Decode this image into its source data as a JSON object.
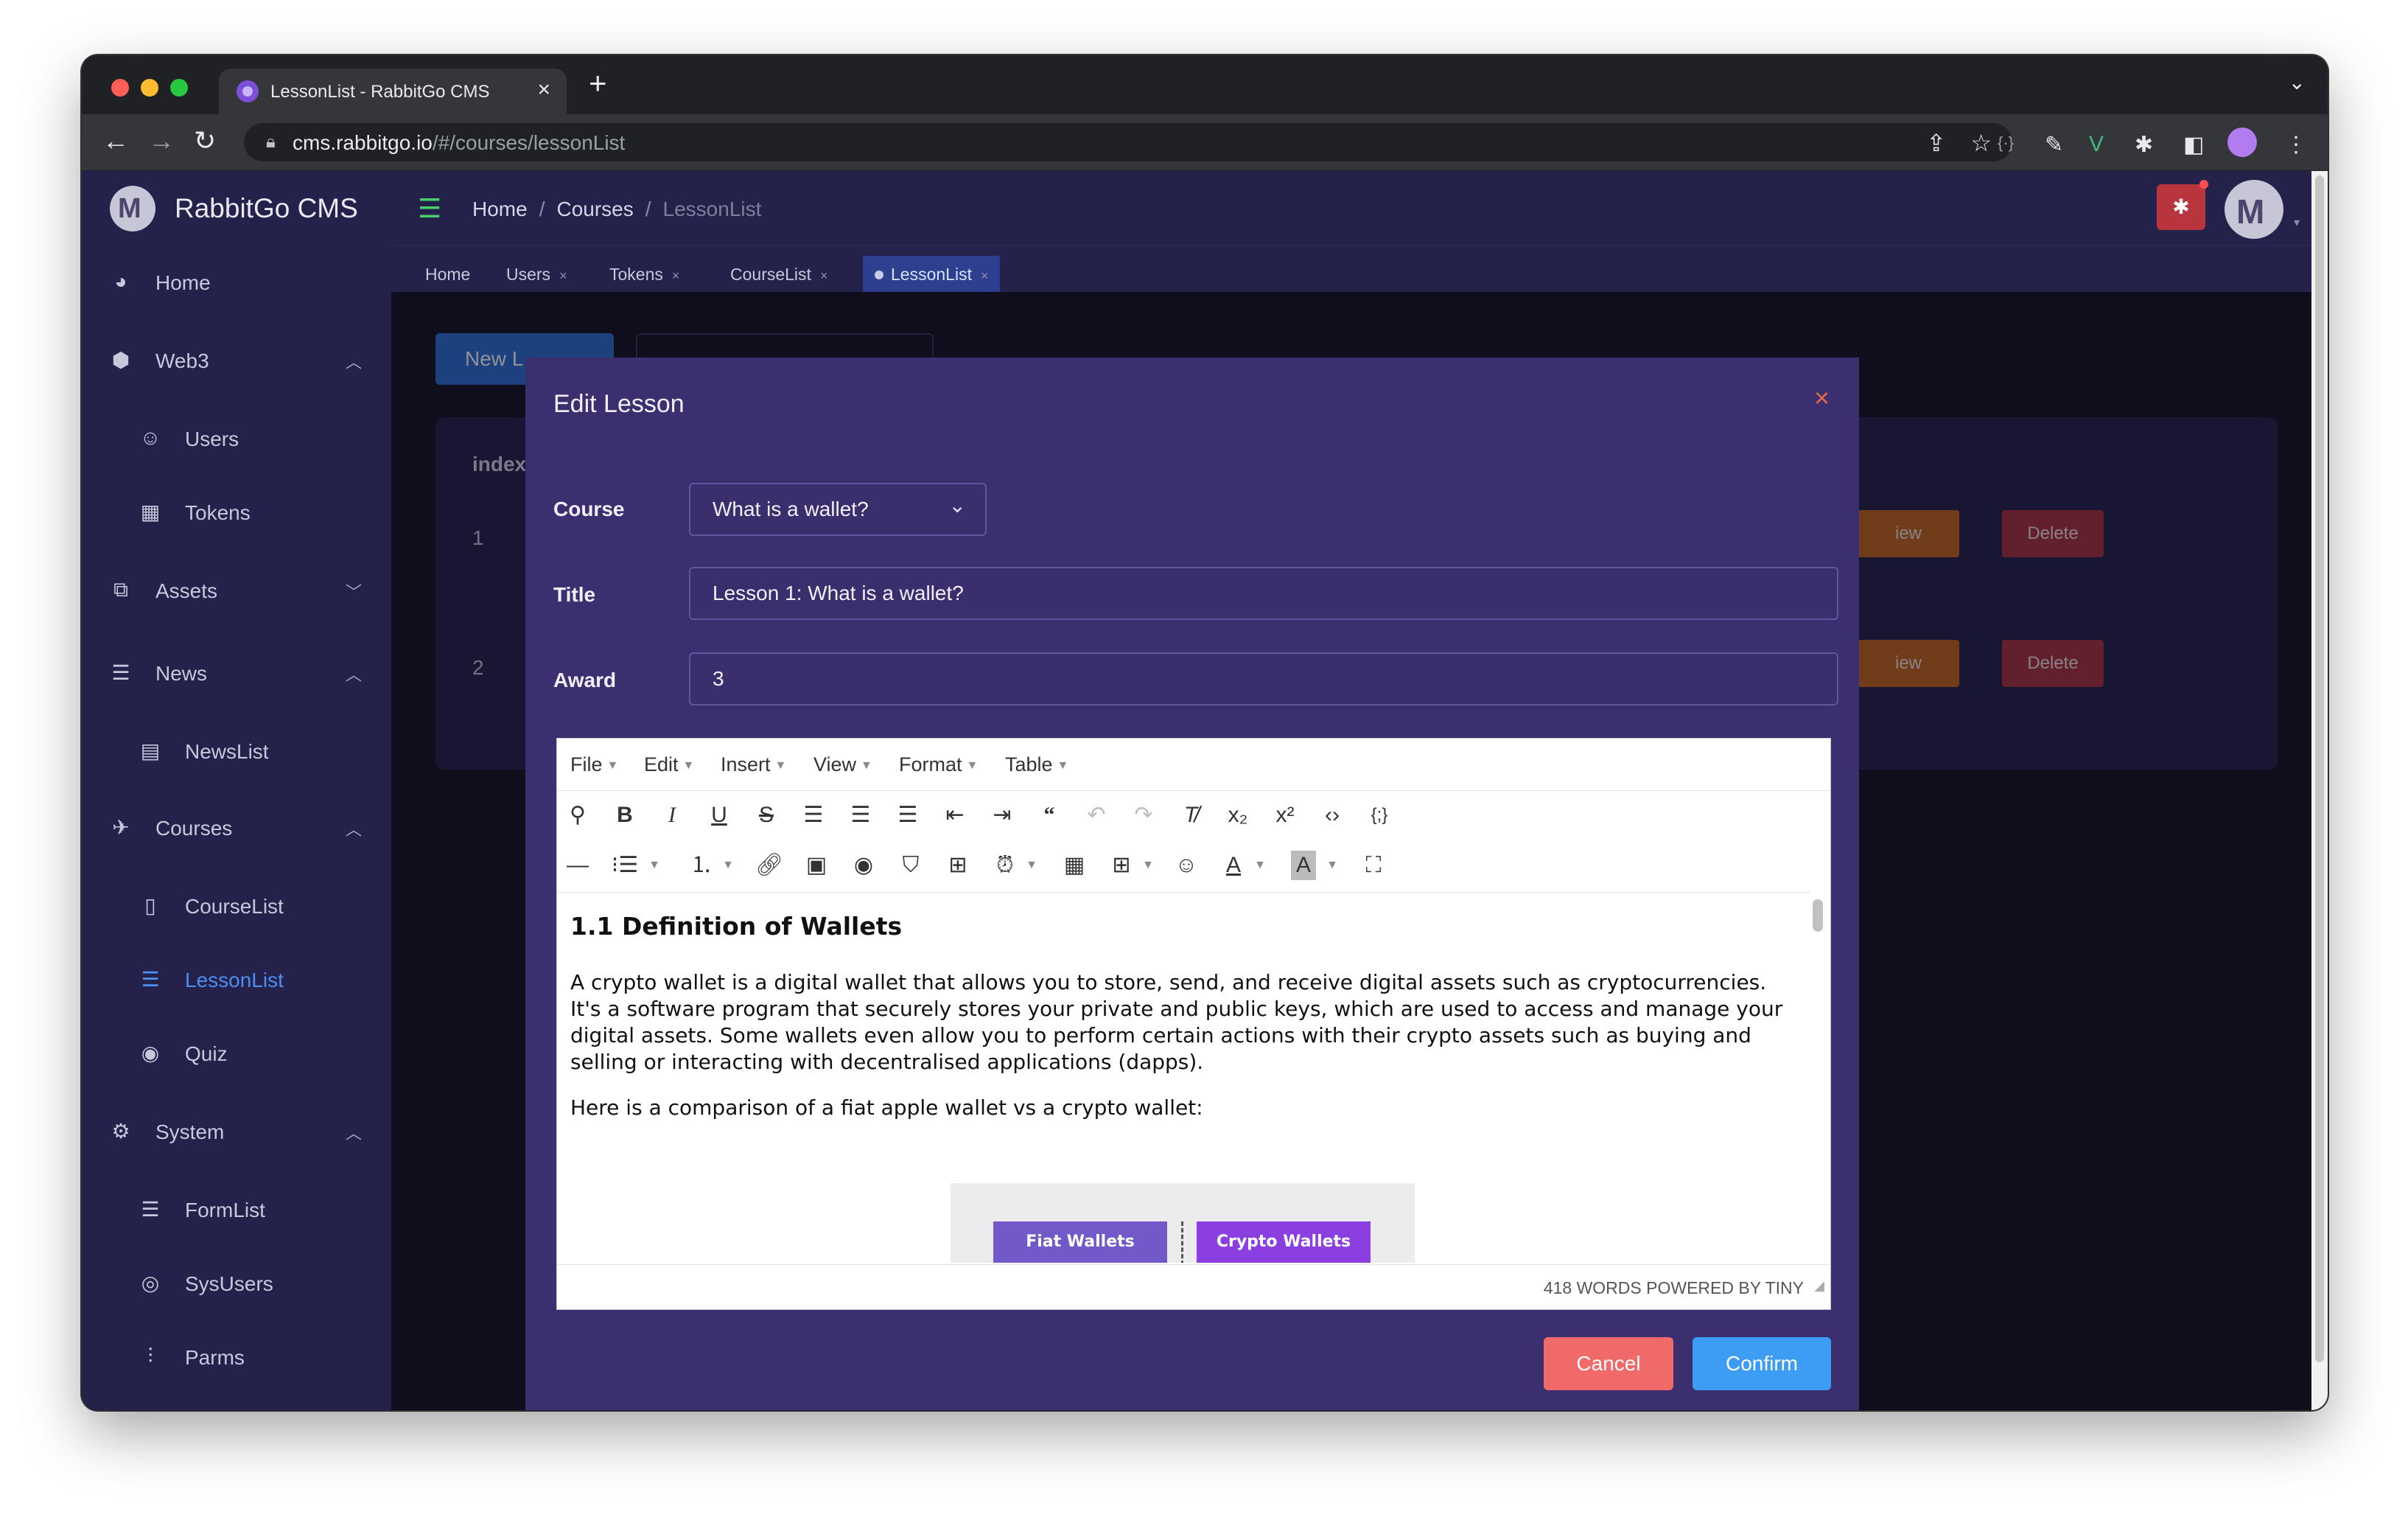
{
  "browser": {
    "tab_title": "LessonList - RabbitGo CMS",
    "tab_close": "×",
    "new_tab": "+",
    "url_host": "cms.rabbitgo.io",
    "url_path": "/#/courses/lessonList"
  },
  "sidebar": {
    "brand": "RabbitGo CMS",
    "items": [
      {
        "label": "Home",
        "icon": "dashboard-icon"
      },
      {
        "label": "Web3",
        "icon": "web3-icon"
      },
      {
        "label": "Users",
        "icon": "users-icon"
      },
      {
        "label": "Tokens",
        "icon": "tokens-icon"
      },
      {
        "label": "Assets",
        "icon": "assets-icon"
      },
      {
        "label": "News",
        "icon": "news-icon"
      },
      {
        "label": "NewsList",
        "icon": "newslist-icon"
      },
      {
        "label": "Courses",
        "icon": "courses-icon"
      },
      {
        "label": "CourseList",
        "icon": "book-icon"
      },
      {
        "label": "LessonList",
        "icon": "list-icon"
      },
      {
        "label": "Quiz",
        "icon": "eye-icon"
      },
      {
        "label": "System",
        "icon": "settings-icon"
      },
      {
        "label": "FormList",
        "icon": "formlist-icon"
      },
      {
        "label": "SysUsers",
        "icon": "sysusers-icon"
      },
      {
        "label": "Parms",
        "icon": "sliders-icon"
      }
    ]
  },
  "breadcrumb": {
    "items": [
      "Home",
      "Courses",
      "LessonList"
    ],
    "separator": "/"
  },
  "tags": [
    {
      "label": "Home"
    },
    {
      "label": "Users"
    },
    {
      "label": "Tokens"
    },
    {
      "label": "CourseList"
    },
    {
      "label": "LessonList"
    }
  ],
  "main": {
    "new_button": "New L",
    "table_header_index": "index",
    "rows": [
      {
        "index": "1",
        "view_label": "iew",
        "delete_label": "Delete"
      },
      {
        "index": "2",
        "view_label": "iew",
        "delete_label": "Delete"
      }
    ]
  },
  "modal": {
    "title": "Edit Lesson",
    "close": "×",
    "course_label": "Course",
    "course_value": "What is a wallet?",
    "title_label": "Title",
    "title_value": "Lesson 1: What is a wallet?",
    "award_label": "Award",
    "award_value": "3",
    "cancel_label": "Cancel",
    "confirm_label": "Confirm"
  },
  "editor": {
    "menus": [
      "File",
      "Edit",
      "Insert",
      "View",
      "Format",
      "Table"
    ],
    "heading": "1.1 Definition of Wallets",
    "paragraph1": "A crypto wallet is a digital wallet that allows you to store, send, and receive digital assets such as cryptocurrencies. It's a software program that securely stores your private and public keys, which are used to access and manage your digital assets. Some wallets even allow you to perform certain actions with their crypto assets such as buying and selling or interacting with decentralised applications (dapps).",
    "paragraph2": "Here is a comparison of a fiat apple wallet vs a crypto wallet:",
    "figure_left": "Fiat Wallets",
    "figure_right": "Crypto Wallets",
    "status": "418 WORDS POWERED BY TINY"
  },
  "colors": {
    "sidebar_bg": "#24214a",
    "modal_bg": "#3c2f70",
    "accent_blue": "#3d9df5",
    "danger": "#f06a6a",
    "active_nav": "#4d8ff0"
  }
}
